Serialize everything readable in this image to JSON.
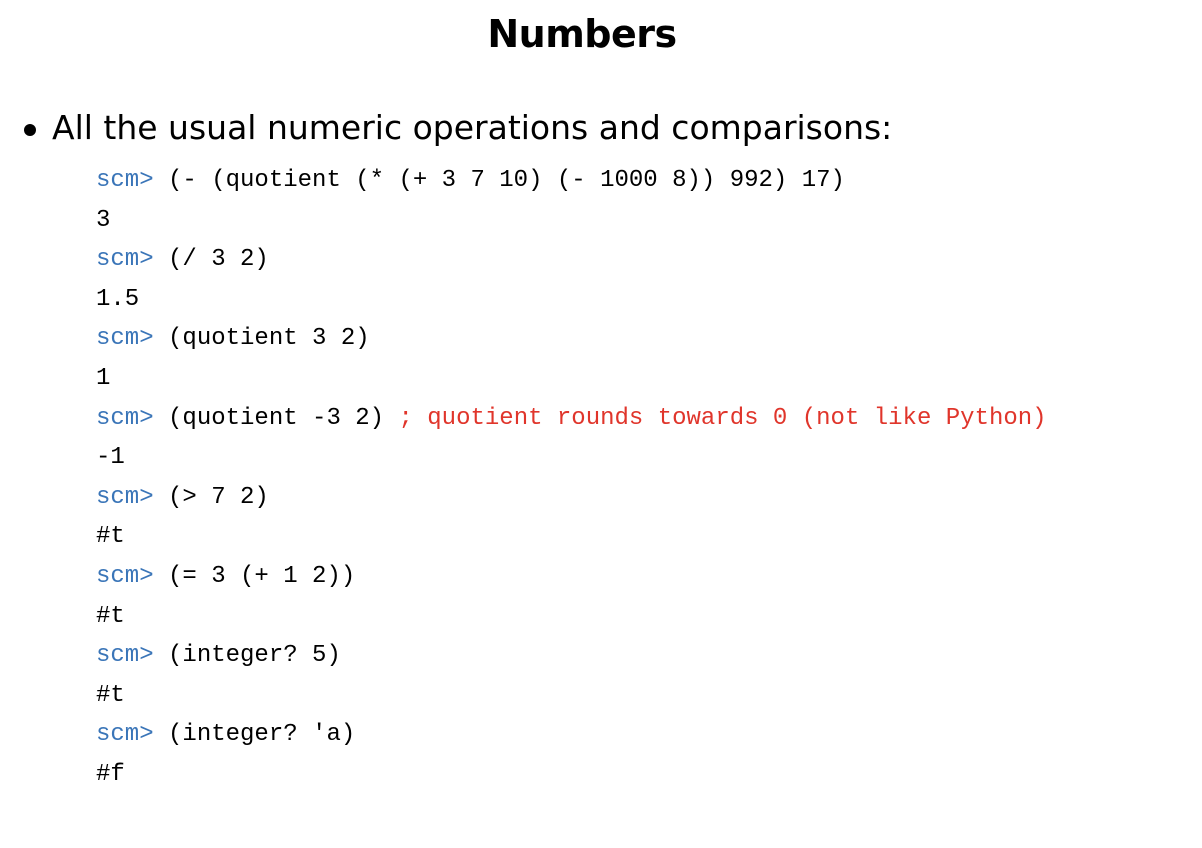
{
  "slide": {
    "title": "Numbers",
    "bullet": "All the usual numeric operations and comparisons:"
  },
  "colors": {
    "prompt": "#3a75b8",
    "comment": "#e0352b",
    "text": "#000000"
  },
  "session": {
    "prompt": "scm>",
    "lines": [
      {
        "kind": "input",
        "code": "(- (quotient (* (+ 3 7 10) (- 1000 8)) 992) 17)",
        "comment": ""
      },
      {
        "kind": "output",
        "text": "3"
      },
      {
        "kind": "input",
        "code": "(/ 3 2)",
        "comment": ""
      },
      {
        "kind": "output",
        "text": "1.5"
      },
      {
        "kind": "input",
        "code": "(quotient 3 2)",
        "comment": ""
      },
      {
        "kind": "output",
        "text": "1"
      },
      {
        "kind": "input",
        "code": "(quotient -3 2)",
        "comment": "; quotient rounds towards 0 (not like Python)"
      },
      {
        "kind": "output",
        "text": "-1"
      },
      {
        "kind": "input",
        "code": "(> 7 2)",
        "comment": ""
      },
      {
        "kind": "output",
        "text": "#t"
      },
      {
        "kind": "input",
        "code": "(= 3 (+ 1 2))",
        "comment": ""
      },
      {
        "kind": "output",
        "text": "#t"
      },
      {
        "kind": "input",
        "code": "(integer? 5)",
        "comment": ""
      },
      {
        "kind": "output",
        "text": "#t"
      },
      {
        "kind": "input",
        "code": "(integer? 'a)",
        "comment": ""
      },
      {
        "kind": "output",
        "text": "#f"
      }
    ]
  }
}
